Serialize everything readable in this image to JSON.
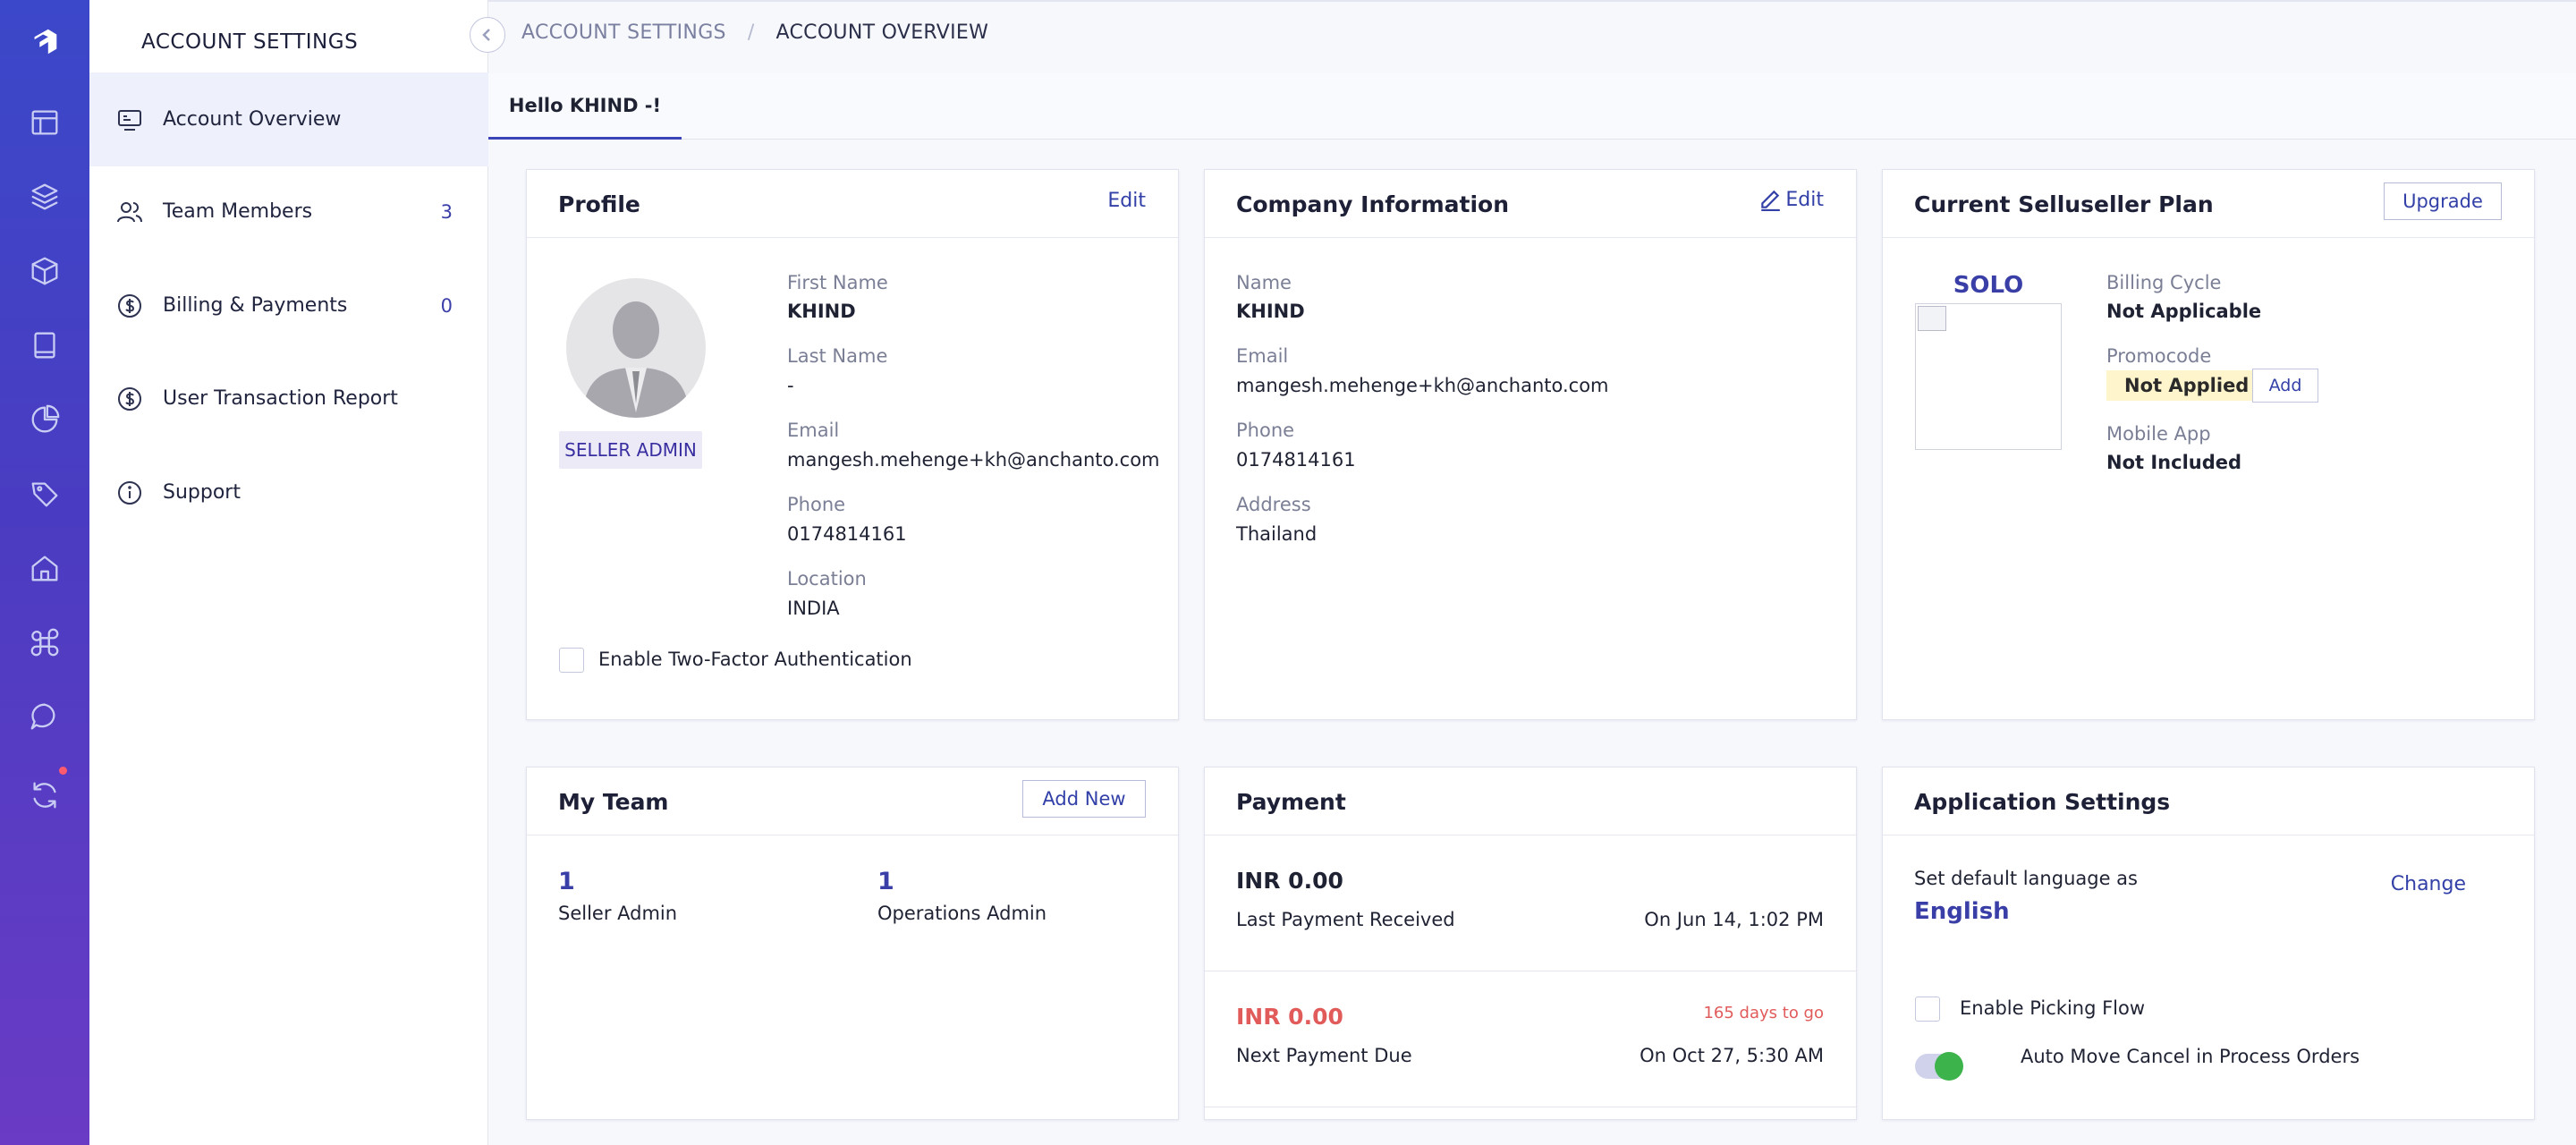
{
  "sidebar": {
    "title": "ACCOUNT SETTINGS",
    "items": [
      {
        "label": "Account Overview",
        "count": ""
      },
      {
        "label": "Team Members",
        "count": "3"
      },
      {
        "label": "Billing & Payments",
        "count": "0"
      },
      {
        "label": "User Transaction Report",
        "count": ""
      },
      {
        "label": "Support",
        "count": ""
      }
    ]
  },
  "breadcrumb": {
    "parent": "ACCOUNT SETTINGS",
    "separator": "/",
    "current": "ACCOUNT OVERVIEW"
  },
  "tab": {
    "label": "Hello KHIND -!"
  },
  "profile": {
    "title": "Profile",
    "edit_label": "Edit",
    "role": "SELLER ADMIN",
    "fields": [
      {
        "label": "First Name",
        "value": "KHIND"
      },
      {
        "label": "Last Name",
        "value": "-"
      },
      {
        "label": "Email",
        "value": "mangesh.mehenge+kh@anchanto.com"
      },
      {
        "label": "Phone",
        "value": "0174814161"
      },
      {
        "label": "Location",
        "value": "INDIA"
      }
    ],
    "two_factor_label": "Enable Two-Factor Authentication"
  },
  "company": {
    "title": "Company Information",
    "edit_label": "Edit",
    "fields": [
      {
        "label": "Name",
        "value": "KHIND"
      },
      {
        "label": "Email",
        "value": "mangesh.mehenge+kh@anchanto.com"
      },
      {
        "label": "Phone",
        "value": "0174814161"
      },
      {
        "label": "Address",
        "value": "Thailand"
      }
    ]
  },
  "plan": {
    "title": "Current Selluseller Plan",
    "upgrade_label": "Upgrade",
    "plan_name": "SOLO",
    "billing_cycle_label": "Billing Cycle",
    "billing_cycle_value": "Not Applicable",
    "promocode_label": "Promocode",
    "promocode_value": "Not Applied",
    "promocode_add": "Add",
    "mobile_app_label": "Mobile App",
    "mobile_app_value": "Not Included"
  },
  "team": {
    "title": "My Team",
    "add_label": "Add New",
    "stats": [
      {
        "count": "1",
        "label": "Seller Admin"
      },
      {
        "count": "1",
        "label": "Operations Admin"
      }
    ]
  },
  "payment": {
    "title": "Payment",
    "last": {
      "amount": "INR 0.00",
      "label": "Last Payment Received",
      "date": "On Jun 14, 1:02 PM"
    },
    "next": {
      "amount": "INR 0.00",
      "label": "Next Payment Due",
      "date": "On Oct 27, 5:30 AM",
      "days_left": "165 days to go"
    }
  },
  "app_settings": {
    "title": "Application Settings",
    "language_label": "Set default language as",
    "language_value": "English",
    "change_label": "Change",
    "picking_flow_label": "Enable Picking Flow",
    "auto_move_label": "Auto Move Cancel in Process Orders",
    "auto_move_enabled": true
  },
  "colors": {
    "accent": "#3240a8",
    "rail_top": "#3b48c9",
    "rail_bottom": "#6a3bc4",
    "due": "#e25b5b",
    "toggle_on": "#3cb44b"
  }
}
